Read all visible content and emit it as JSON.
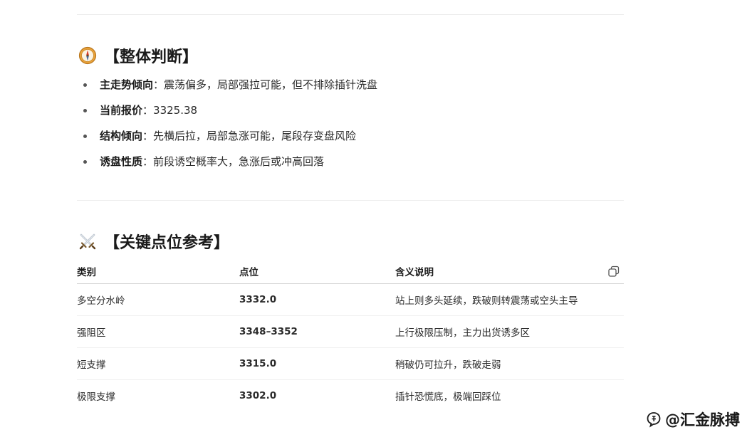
{
  "section1": {
    "title": "【整体判断】",
    "icon": "compass-icon",
    "bullets": [
      {
        "key": "主走势倾向",
        "sep": "：",
        "value": "震荡偏多，局部强拉可能，但不排除插针洗盘"
      },
      {
        "key": "当前报价",
        "sep": "：",
        "value": "3325.38"
      },
      {
        "key": "结构倾向",
        "sep": "：",
        "value": "先横后拉，局部急涨可能，尾段存变盘风险"
      },
      {
        "key": "诱盘性质",
        "sep": "：",
        "value": "前段诱空概率大，急涨后或冲高回落"
      }
    ]
  },
  "section2": {
    "title": "【关键点位参考】",
    "icon": "crossed-swords-icon",
    "table": {
      "headers": [
        "类别",
        "点位",
        "含义说明"
      ],
      "rows": [
        [
          "多空分水岭",
          "3332.0",
          "站上则多头延续，跌破则转震荡或空头主导"
        ],
        [
          "强阻区",
          "3348–3352",
          "上行极限压制，主力出货诱多区"
        ],
        [
          "短支撑",
          "3315.0",
          "稍破仍可拉升，跌破走弱"
        ],
        [
          "极限支撑",
          "3302.0",
          "插针恐慌底，极端回踩位"
        ]
      ]
    },
    "copy_icon": "copy-icon"
  },
  "watermark": {
    "text": "@汇金脉搏",
    "icon": "zhihu-logo-icon"
  }
}
